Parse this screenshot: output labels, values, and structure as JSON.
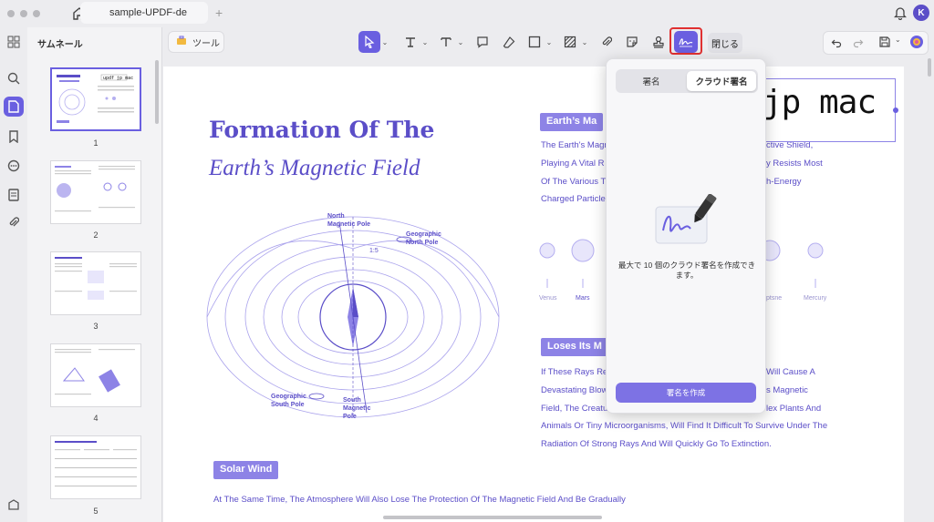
{
  "titlebar": {
    "tab_title": "sample-UPDF-de",
    "add_tab": "+",
    "avatar_initial": "K"
  },
  "left_rail": {
    "icons": [
      "grid-icon",
      "search-icon",
      "page-icon",
      "bookmark-icon",
      "comment-icon",
      "form-icon",
      "attachment-icon",
      "layers-icon"
    ]
  },
  "thumbnails": {
    "title": "サムネール",
    "pages": [
      {
        "num": "1",
        "selected": true
      },
      {
        "num": "2",
        "selected": false
      },
      {
        "num": "3",
        "selected": false
      },
      {
        "num": "4",
        "selected": false
      },
      {
        "num": "5",
        "selected": false
      }
    ]
  },
  "toolbar": {
    "tools_label": "ツール",
    "close_label": "閉じる",
    "icons": [
      "select-icon",
      "text-icon",
      "text-box-icon",
      "comment-bubble-icon",
      "eraser-icon",
      "rectangle-icon",
      "hatch-icon",
      "attachment-icon",
      "sticker-icon",
      "stamp-icon",
      "signature-icon"
    ],
    "active_tool": "signature-icon"
  },
  "document": {
    "title_line1": "Formation Of The",
    "title_line2": "Earth’s Magnetic Field",
    "section1_tag": "Earth’s Ma",
    "section1_lines": [
      "The Earth's Magn",
      "Playing A Vital R",
      "Of The Various T",
      "Charged Particle"
    ],
    "section1_right": [
      "ctive Shield,",
      "y Resists Most",
      "h-Energy"
    ],
    "planets": [
      "Venus",
      "Mars",
      "ptsne",
      "Mercury"
    ],
    "section2_tag": "Loses Its M",
    "section2_lines": [
      "If These Rays Re",
      "Devastating Blow",
      "Field, The Creatu",
      "Animals Or Tiny Microorganisms, Will Find It Difficult To Survive Under The",
      "Radiation Of Strong Rays And Will Quickly Go To Extinction."
    ],
    "section2_right": [
      "Will Cause A",
      "s Magnetic",
      "lex Plants And"
    ],
    "section3_tag": "Solar Wind",
    "section3_line": "At The Same Time, The Atmosphere Will Also Lose The Protection Of The Magnetic Field And Be Gradually",
    "diagram": {
      "north_magnetic": "North\nMagnetic Pole",
      "geo_north": "Geographic\nNorth Pole",
      "ratio": "1:5",
      "geo_south": "Geographic\nSouth Pole",
      "south_magnetic": "South\nMagnetic\nPole"
    },
    "signature_text": "jp mac"
  },
  "popup": {
    "tab_signature": "署名",
    "tab_cloud": "クラウド署名",
    "active_tab": "クラウド署名",
    "message": "最大で 10 個のクラウド署名を作成できます。",
    "create_button": "署名を作成"
  },
  "colors": {
    "accent": "#6a5fe0",
    "doc_text": "#5b4ec8",
    "tag_bg": "#8d83e6",
    "highlight_outline": "#e03030"
  }
}
